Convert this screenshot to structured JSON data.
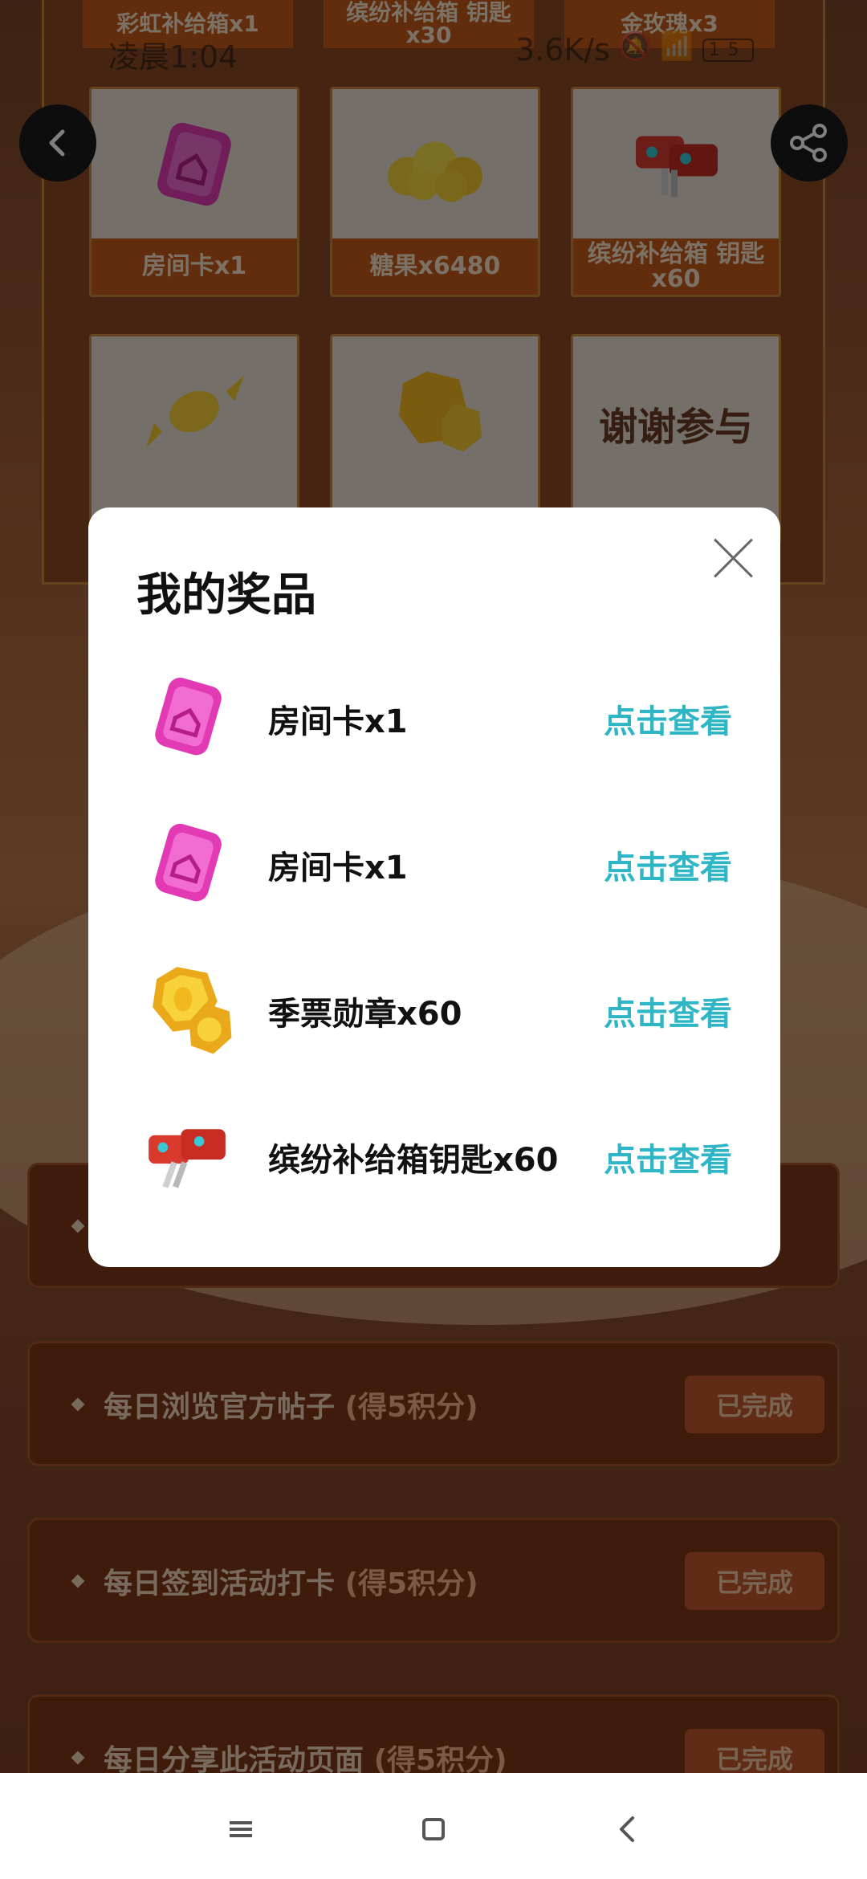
{
  "status_bar": {
    "time": "凌晨1:04",
    "network_speed": "3.6K/s",
    "battery": "15"
  },
  "prize_grid": {
    "top_row_labels": [
      "彩虹补给箱x1",
      "缤纷补给箱\n钥匙x30",
      "金玫瑰x3"
    ],
    "cells": [
      {
        "label": "房间卡x1",
        "icon": "room-card-icon"
      },
      {
        "label": "糖果x6480",
        "icon": "candy-pile-icon"
      },
      {
        "label": "缤纷补给箱\n钥匙x60",
        "icon": "key-icon"
      },
      {
        "label": "",
        "icon": "candy-icon"
      },
      {
        "label": "",
        "icon": "medal-icon"
      },
      {
        "label": "谢谢参与",
        "icon": "thanks-icon"
      }
    ]
  },
  "tasks": [
    {
      "text": "每日浏览官方帖子",
      "points": "(得5积分)",
      "status": "已完成"
    },
    {
      "text": "每日签到活动打卡",
      "points": "(得5积分)",
      "status": "已完成"
    },
    {
      "text": "每日分享此活动页面",
      "points": "(得5积分)",
      "status": "已完成"
    }
  ],
  "modal": {
    "title": "我的奖品",
    "items": [
      {
        "name": "房间卡x1",
        "action": "点击查看",
        "icon": "room-card-icon"
      },
      {
        "name": "房间卡x1",
        "action": "点击查看",
        "icon": "room-card-icon"
      },
      {
        "name": "季票勋章x60",
        "action": "点击查看",
        "icon": "season-medal-icon"
      },
      {
        "name": "缤纷补给箱钥匙x60",
        "action": "点击查看",
        "icon": "supply-key-icon"
      }
    ]
  },
  "colors": {
    "link": "#2fb6c6",
    "background": "#8b4a22",
    "label_band": "#c45a1a"
  }
}
